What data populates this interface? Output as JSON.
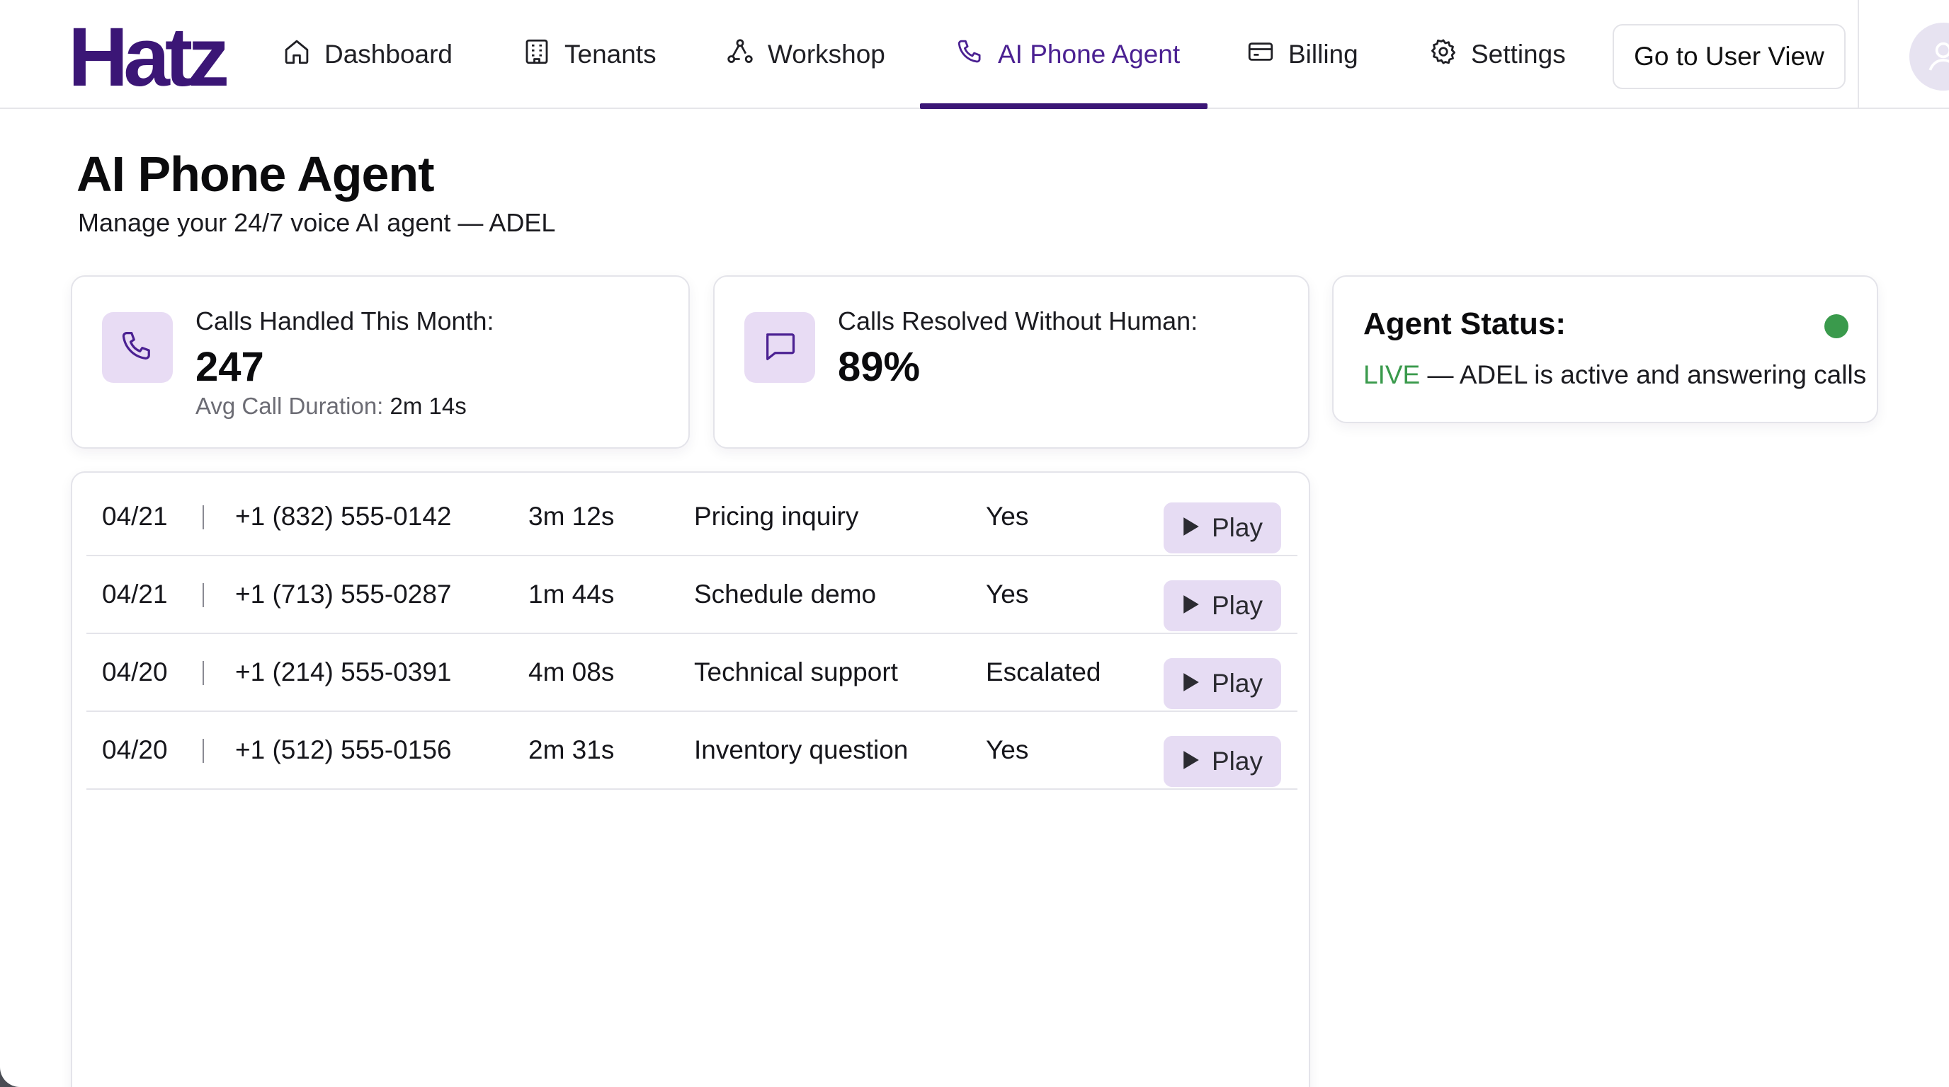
{
  "brand": {
    "logo_text": "Hatz",
    "accent": "#3b1676"
  },
  "nav": {
    "items": [
      {
        "label": "Dashboard",
        "icon": "home-icon"
      },
      {
        "label": "Tenants",
        "icon": "building-icon"
      },
      {
        "label": "Workshop",
        "icon": "workflow-icon"
      },
      {
        "label": "AI Phone Agent",
        "icon": "phone-icon",
        "active": true
      },
      {
        "label": "Billing",
        "icon": "credit-card-icon"
      },
      {
        "label": "Settings",
        "icon": "gear-icon"
      }
    ],
    "user_view_button": "Go to User View",
    "avatar_icon": "user-icon"
  },
  "header": {
    "title": "AI Phone Agent",
    "subtitle": "Manage your 24/7 voice AI agent — ADEL"
  },
  "stats": {
    "calls_handled": {
      "label": "Calls Handled This Month:",
      "value": "247",
      "sub_label": "Avg Call Duration:",
      "sub_value": "2m 14s",
      "icon": "phone-icon"
    },
    "calls_resolved": {
      "label": "Calls Resolved Without Human:",
      "value": "89%",
      "icon": "chat-bubble-icon"
    }
  },
  "agent_status": {
    "title": "Agent Status:",
    "state": "LIVE",
    "message": "— ADEL is active and answering calls",
    "status_color": "#3a9a4c"
  },
  "calls": {
    "play_label": "Play",
    "rows": [
      {
        "date": "04/21",
        "phone": "+1 (832) 555-0142",
        "duration": "3m 12s",
        "topic": "Pricing inquiry",
        "resolved": "Yes"
      },
      {
        "date": "04/21",
        "phone": "+1 (713) 555-0287",
        "duration": "1m 44s",
        "topic": "Schedule demo",
        "resolved": "Yes"
      },
      {
        "date": "04/20",
        "phone": "+1 (214) 555-0391",
        "duration": "4m 08s",
        "topic": "Technical support",
        "resolved": "Escalated"
      },
      {
        "date": "04/20",
        "phone": "+1 (512) 555-0156",
        "duration": "2m 31s",
        "topic": "Inventory question",
        "resolved": "Yes"
      }
    ]
  }
}
